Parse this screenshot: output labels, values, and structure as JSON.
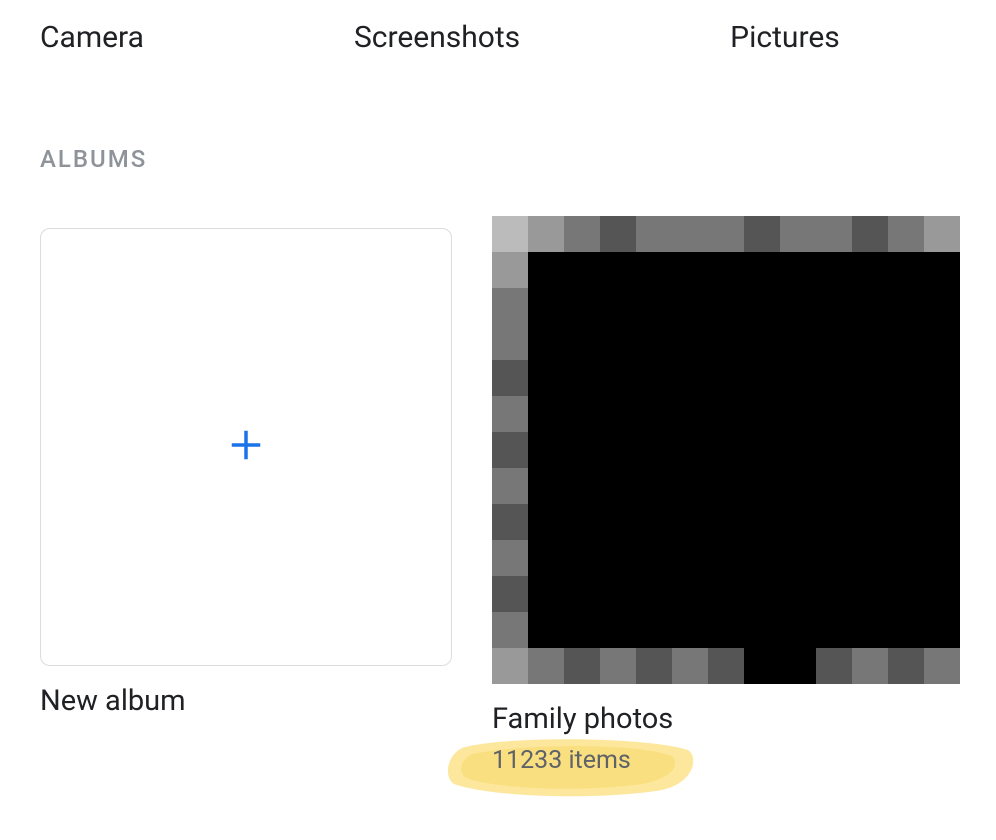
{
  "folders": [
    {
      "label": "Camera"
    },
    {
      "label": "Screenshots"
    },
    {
      "label": "Pictures"
    }
  ],
  "section": {
    "title": "ALBUMS"
  },
  "albums": {
    "newAlbum": {
      "label": "New album"
    },
    "family": {
      "label": "Family photos",
      "subtitle": "11233 items"
    }
  },
  "icons": {
    "plus": "plus-icon"
  },
  "colors": {
    "accentBlue": "#1a73e8",
    "highlight": "#fbe38b"
  }
}
